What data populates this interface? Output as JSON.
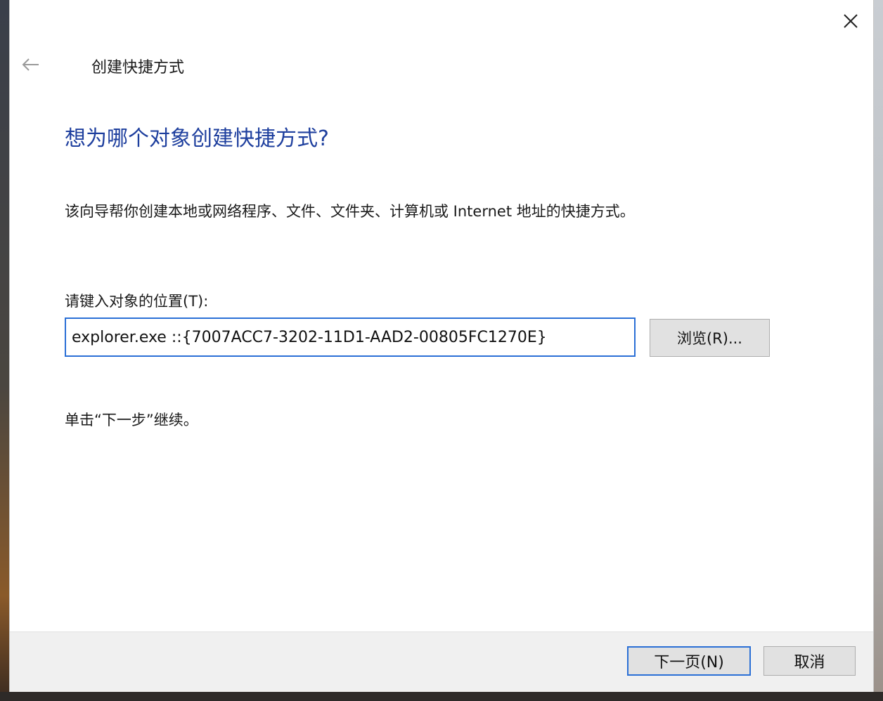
{
  "window": {
    "title": "创建快捷方式",
    "close_icon": "close-icon",
    "back_icon": "arrow-left-icon"
  },
  "main": {
    "heading": "想为哪个对象创建快捷方式?",
    "description": "该向导帮你创建本地或网络程序、文件、文件夹、计算机或 Internet 地址的快捷方式。",
    "location_label": "请键入对象的位置(T):",
    "location_value": "explorer.exe ::{7007ACC7-3202-11D1-AAD2-00805FC1270E}",
    "browse_label": "浏览(R)...",
    "hint": "单击“下一步”继续。"
  },
  "footer": {
    "next_label": "下一页(N)",
    "cancel_label": "取消"
  },
  "colors": {
    "heading": "#1e3f9e",
    "focus_border": "#2a6fd6",
    "button_bg": "#e1e1e1",
    "footer_bg": "#f0f0f0"
  }
}
